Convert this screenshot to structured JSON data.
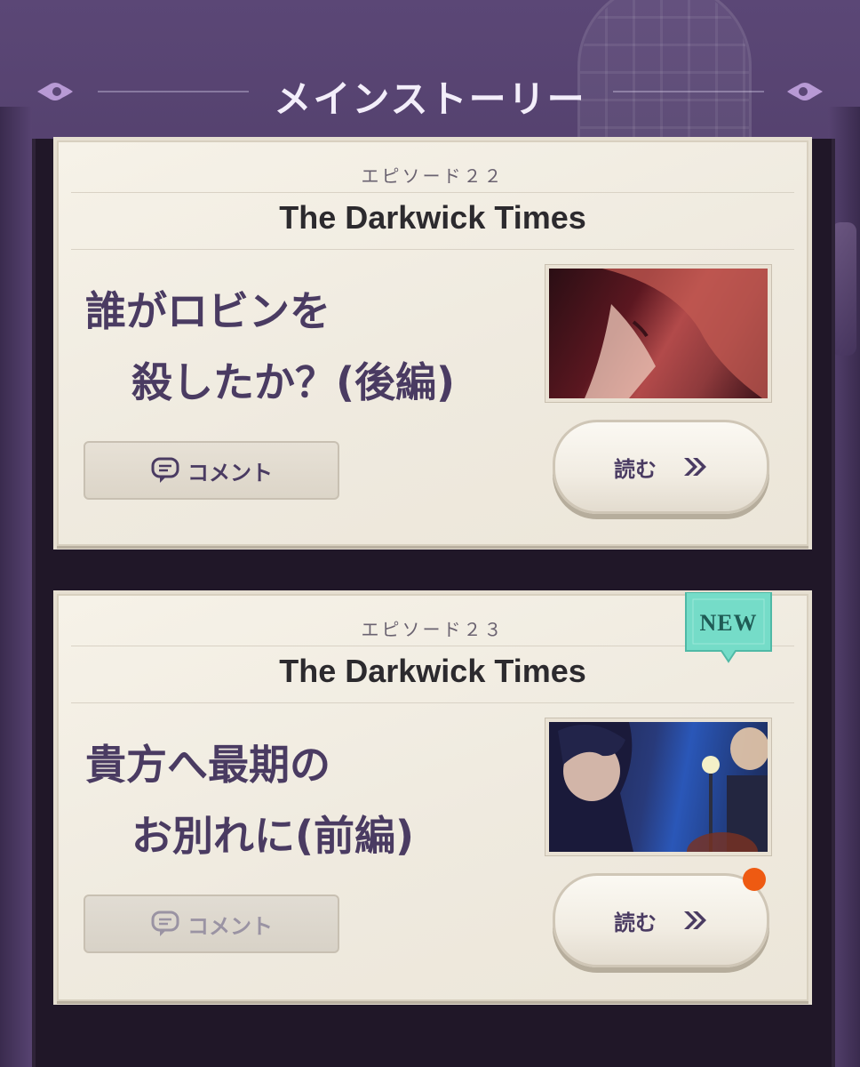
{
  "header": {
    "title": "メインストーリー"
  },
  "cards": [
    {
      "episode": "エピソード２２",
      "title": "The Darkwick Times",
      "story_title_line1": "誰がロビンを",
      "story_title_line2": "殺したか？(後編)",
      "comment_label": "コメント",
      "read_label": "読む",
      "is_new": false
    },
    {
      "episode": "エピソード２３",
      "title": "The Darkwick Times",
      "story_title_line1": "貴方へ最期の",
      "story_title_line2": "お別れに(前編)",
      "comment_label": "コメント",
      "read_label": "読む",
      "badge": "NEW",
      "is_new": true
    }
  ],
  "colors": {
    "accent": "#4a3b62",
    "badge": "#6fd8c4",
    "notification": "#ee5a12"
  },
  "icons": [
    "ornament-icon",
    "comment-icon",
    "double-chevron-right-icon"
  ]
}
